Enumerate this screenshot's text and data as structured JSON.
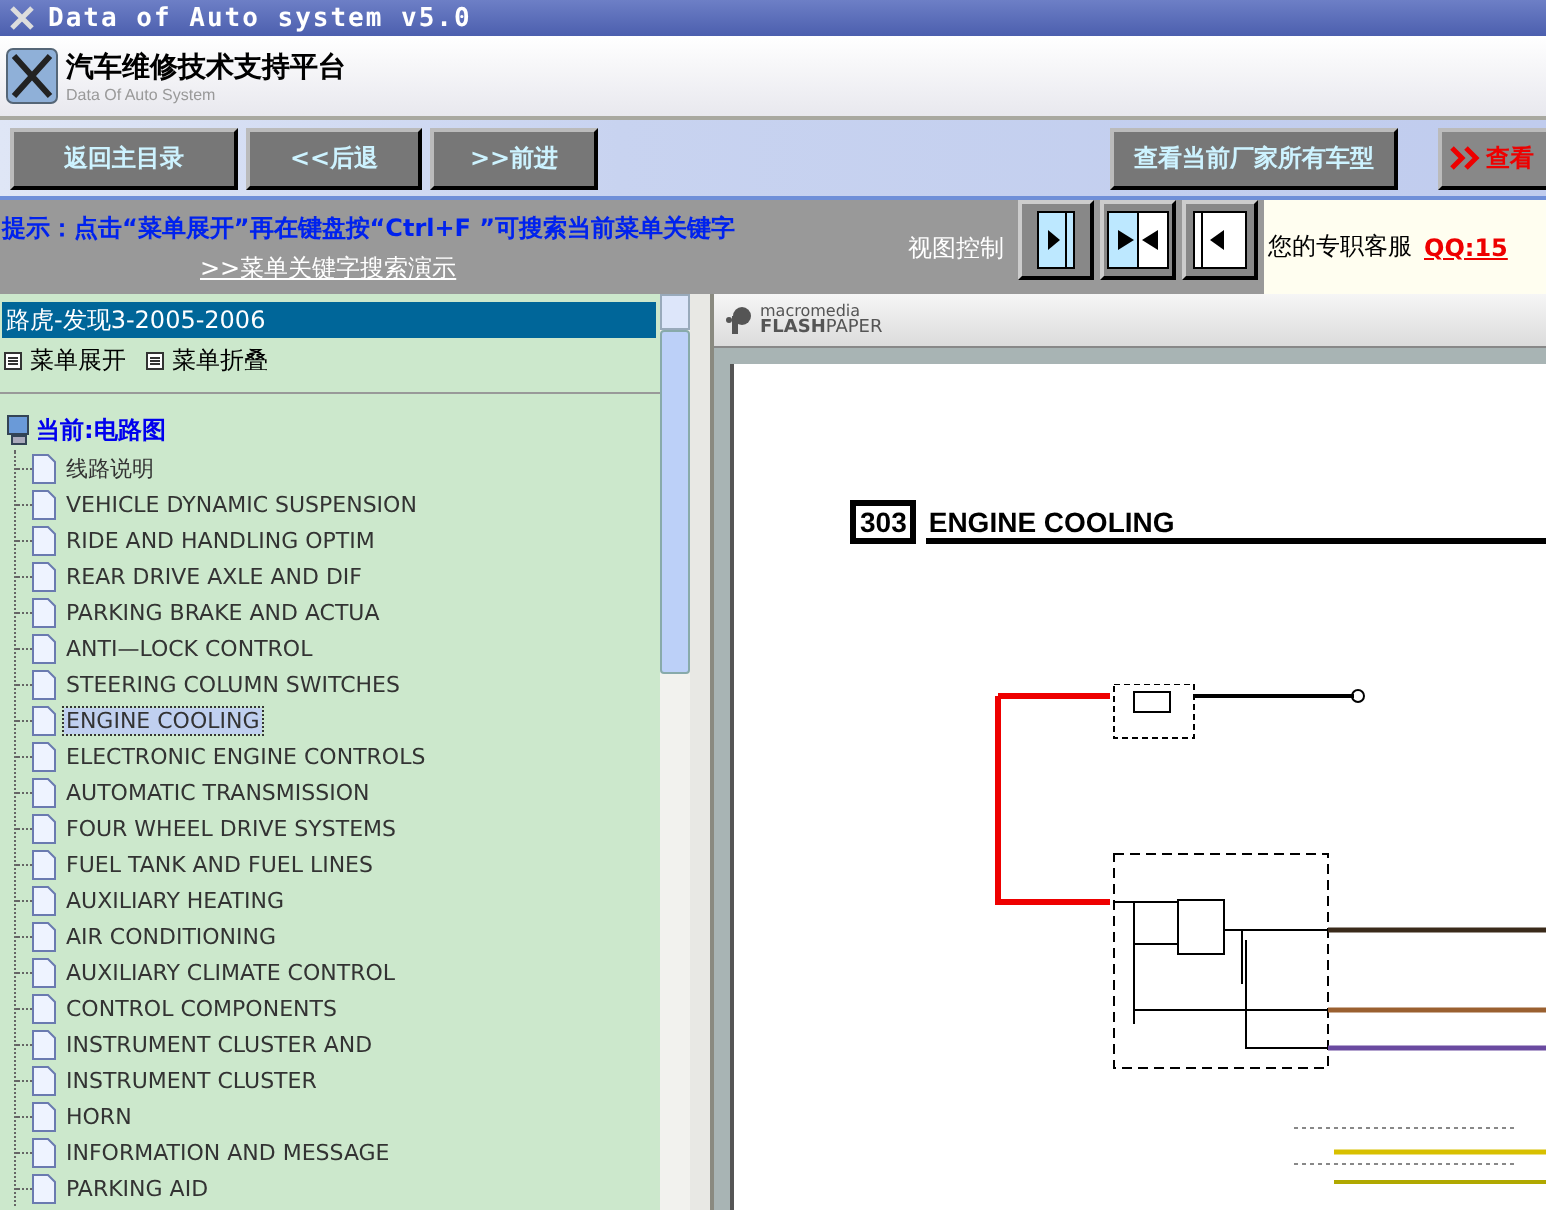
{
  "window": {
    "title": "Data of Auto system v5.0"
  },
  "header": {
    "title": "汽车维修技术支持平台",
    "subtitle": "Data Of Auto System"
  },
  "toolbar": {
    "buttons": [
      "返回主目录",
      "<<后退",
      ">>前进"
    ],
    "right_buttons": [
      {
        "label": "查看当前厂家所有车型",
        "kind": "plain"
      },
      {
        "label": "查看",
        "kind": "chevron"
      }
    ]
  },
  "hint": {
    "text": "提示：点击“菜单展开”再在键盘按“Ctrl+F ”可搜索当前菜单关键字",
    "link": ">>菜单关键字搜索演示"
  },
  "view_control": {
    "label": "视图控制",
    "buttons": [
      {
        "kind": "right"
      },
      {
        "kind": "both"
      },
      {
        "kind": "left"
      }
    ]
  },
  "support": {
    "label": "您的专职客服",
    "qq": "QQ:15"
  },
  "sidebar": {
    "model": {
      "label": "路虎-发现3-2005-2006",
      "selected": true
    },
    "actions": [
      "菜单展开",
      "菜单折叠"
    ],
    "current": "当前:电路图",
    "items": [
      {
        "label": "线路说明",
        "selected": false
      },
      {
        "label": "VEHICLE DYNAMIC SUSPENSION",
        "selected": false
      },
      {
        "label": "RIDE AND HANDLING OPTIM",
        "selected": false
      },
      {
        "label": "REAR DRIVE AXLE AND DIF",
        "selected": false
      },
      {
        "label": "PARKING BRAKE AND ACTUA",
        "selected": false
      },
      {
        "label": "ANTI—LOCK CONTROL",
        "selected": false
      },
      {
        "label": "STEERING COLUMN SWITCHES",
        "selected": false
      },
      {
        "label": "ENGINE COOLING",
        "selected": true
      },
      {
        "label": "ELECTRONIC ENGINE CONTROLS",
        "selected": false
      },
      {
        "label": "AUTOMATIC TRANSMISSION",
        "selected": false
      },
      {
        "label": "FOUR WHEEL DRIVE SYSTEMS",
        "selected": false
      },
      {
        "label": "FUEL TANK AND FUEL LINES",
        "selected": false
      },
      {
        "label": "AUXILIARY HEATING",
        "selected": false
      },
      {
        "label": "AIR CONDITIONING",
        "selected": false
      },
      {
        "label": "AUXILIARY CLIMATE CONTROL",
        "selected": false
      },
      {
        "label": "CONTROL COMPONENTS",
        "selected": false
      },
      {
        "label": "INSTRUMENT CLUSTER AND",
        "selected": false
      },
      {
        "label": "INSTRUMENT CLUSTER",
        "selected": false
      },
      {
        "label": "HORN",
        "selected": false
      },
      {
        "label": "INFORMATION AND MESSAGE",
        "selected": false
      },
      {
        "label": "PARKING AID",
        "selected": false
      }
    ]
  },
  "viewer": {
    "brand_top": "macromedia",
    "brand_bottom": "**FLASH**PAPER",
    "section_number": "303",
    "section_title": "ENGINE COOLING"
  }
}
